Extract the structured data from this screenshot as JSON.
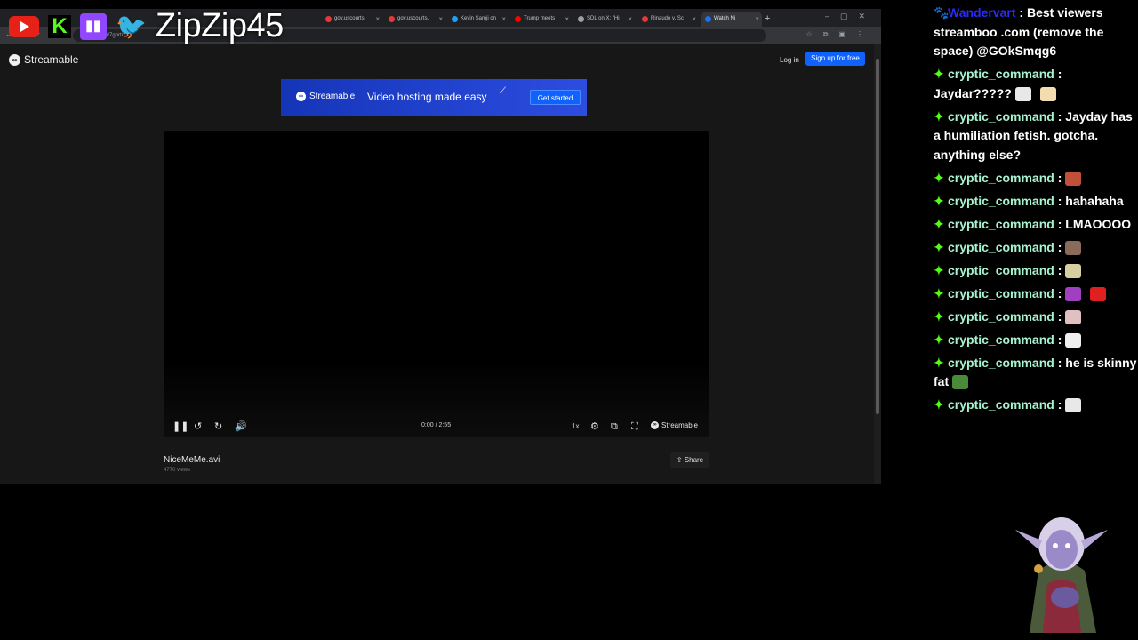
{
  "overlay": {
    "streamer_handle": "ZipZip45",
    "social_icons": [
      "youtube-icon",
      "kick-icon",
      "twitch-icon",
      "twitter-icon"
    ]
  },
  "browser": {
    "tabs": [
      {
        "label": "gov.uscourts.",
        "color": "#e53935"
      },
      {
        "label": "gov.uscourts.",
        "color": "#e53935"
      },
      {
        "label": "Kevin Samji on",
        "color": "#1da1f2"
      },
      {
        "label": "Trump meets",
        "color": "#ff0000"
      },
      {
        "label": "SDL on X: \"Hi",
        "color": "#9aa0a6"
      },
      {
        "label": "Rinaudo v. Sc",
        "color": "#e53935"
      },
      {
        "label": "Watch Ni",
        "color": "#1a73e8"
      }
    ],
    "url": "mable.com/7gbrtiz"
  },
  "site": {
    "brand": "Streamable",
    "login": "Log in",
    "signup": "Sign up for free",
    "banner": {
      "brand": "Streamable",
      "tagline": "Video hosting made easy",
      "cta": "Get started"
    },
    "player": {
      "time": "0:00 / 2:55",
      "speed": "1x",
      "brand": "Streamable"
    },
    "video": {
      "title": "NiceMeMe.avi",
      "views": "4770 views",
      "share": "Share"
    }
  },
  "chat": {
    "messages": [
      {
        "user": "Wandervart",
        "text": "Best viewers streamboo .com (remove the space) @GOkSmqg6",
        "badge": "🐾",
        "user_color": "#2a2aff"
      },
      {
        "user": "cryptic_command",
        "text": "Jaydar?????",
        "emotes": [
          "#e8e8e8",
          "#f3dcb0"
        ]
      },
      {
        "user": "cryptic_command",
        "text": "Jayday has a humiliation fetish. gotcha. anything else?"
      },
      {
        "user": "cryptic_command",
        "text": "",
        "emotes": [
          "#c0503a"
        ]
      },
      {
        "user": "cryptic_command",
        "text": "hahahaha"
      },
      {
        "user": "cryptic_command",
        "text": "LMAOOOO"
      },
      {
        "user": "cryptic_command",
        "text": "",
        "emotes": [
          "#8a6a5a"
        ]
      },
      {
        "user": "cryptic_command",
        "text": "",
        "emotes": [
          "#d8cfa0"
        ]
      },
      {
        "user": "cryptic_command",
        "text": "",
        "emotes": [
          "#a040c0",
          "#e02020"
        ]
      },
      {
        "user": "cryptic_command",
        "text": "",
        "emotes": [
          "#e0c0c0"
        ]
      },
      {
        "user": "cryptic_command",
        "text": "",
        "emotes": [
          "#f0f0f0"
        ]
      },
      {
        "user": "cryptic_command",
        "text": "he is skinny fat",
        "emotes": [
          "#4a8a3a"
        ]
      },
      {
        "user": "cryptic_command",
        "text": "",
        "emotes": [
          "#e8e8e8"
        ]
      }
    ]
  }
}
